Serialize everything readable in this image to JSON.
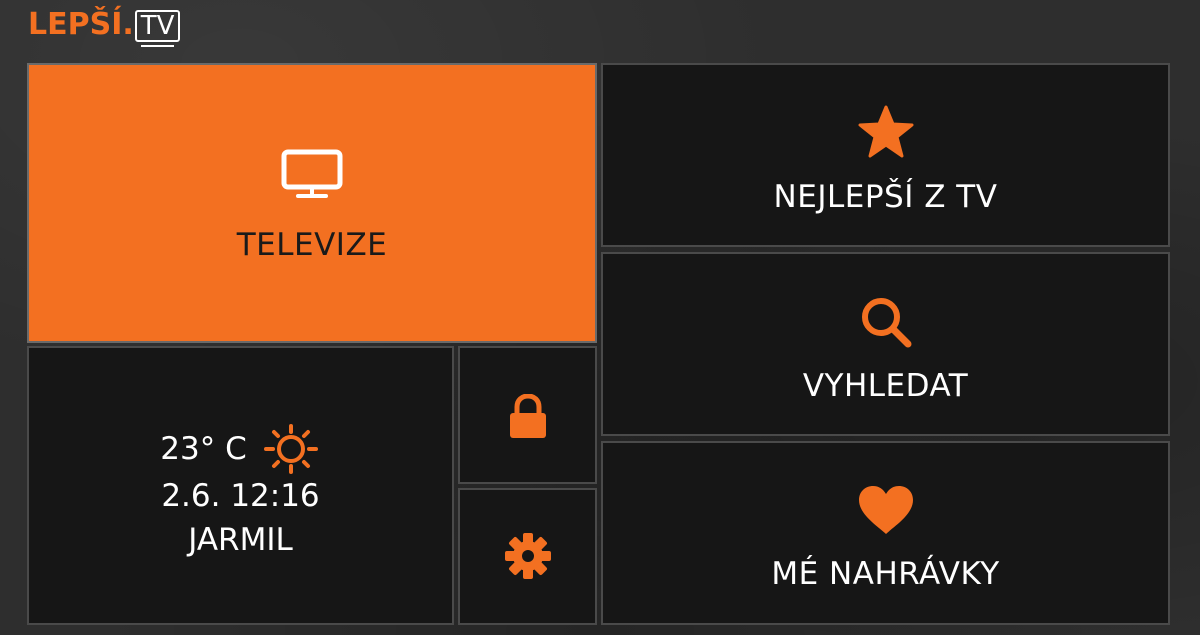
{
  "logo": {
    "brand": "LEPŠÍ",
    "dot": ".",
    "tv": "TV"
  },
  "tiles": {
    "televize": {
      "label": "TELEVIZE",
      "icon": "tv-icon",
      "active": true
    },
    "nejlepsi": {
      "label": "NEJLEPŠÍ Z TV",
      "icon": "star-icon"
    },
    "vyhledat": {
      "label": "VYHLEDAT",
      "icon": "search-icon"
    },
    "nahravky": {
      "label": "MÉ NAHRÁVKY",
      "icon": "heart-icon"
    },
    "lock": {
      "icon": "lock-icon"
    },
    "settings": {
      "icon": "gear-icon"
    }
  },
  "info": {
    "temperature": "23° C",
    "weather_icon": "sun-icon",
    "datetime": "2.6. 12:16",
    "user": "JARMIL"
  },
  "colors": {
    "accent": "#f37021",
    "tile_bg": "#161616",
    "tile_border": "#4a4a4a",
    "background": "#2e2e2e"
  }
}
